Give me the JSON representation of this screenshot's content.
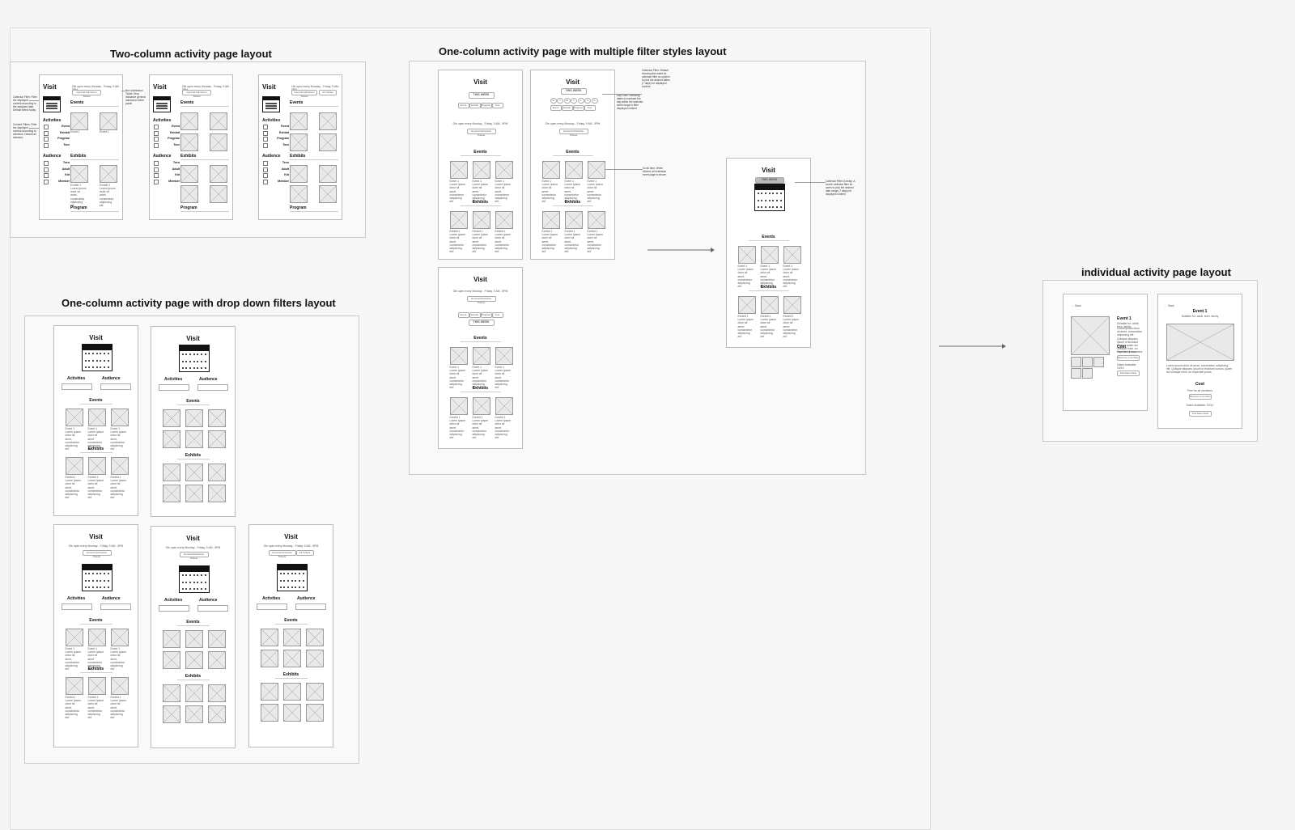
{
  "sections": {
    "two_column": "Two-column activity page layout",
    "multi_filter": "One-column activity page with multiple filter styles layout",
    "dropdown": "One-column activity page with drop down filters layout",
    "individual": "individual activity page layout"
  },
  "page": {
    "visit": "Visit",
    "hours": "Ole open every Monday - Friday, 9 AM - 5PM",
    "hours_short": "Ole open every Monday - Friday, 9 AM - 5PM",
    "plan_btn": "General Admission Tickets",
    "events": "Events",
    "exhibits": "Exhibits",
    "program": "Program",
    "activities": "Activities",
    "audience": "Audience",
    "this_week": "THIS WEEK",
    "event_item": "Event 1",
    "exhibit_item": "Exhibit 1",
    "exhibit_item2": "Exhibit 2",
    "lorem": "Lorem ipsum dolor sit amet, consectetur adipiscing elit.",
    "all_tickets": "All Tickets"
  },
  "activity_filters": [
    "Event",
    "Exhibit",
    "Program",
    "Tour"
  ],
  "audience_filters": [
    "Teen",
    "Adult",
    "Kid",
    "Member"
  ],
  "tags": [
    "Event",
    "Exhibit",
    "Program",
    "Tour"
  ],
  "days": [
    "M",
    "T",
    "W",
    "T",
    "F",
    "S",
    "S"
  ],
  "annotations": {
    "calendar_filter": "Calendar Filter: Filter the displayed content according to the assigned date. Default select today.",
    "content_filters": "Content Filters: Filter the displayed content according to selection. Default all selected.",
    "non_admission": "Non-Admission Ticket: Drop indicative general admission ticket portal",
    "day_filter": "Day Filter: Selecting dates to increase the day within the selected week range to filter displayed content",
    "scroll_item": "Scroll Item: When clicked, all individual event page is shown",
    "cal_overlay": "Calendar Filter Overlay: A month calendar filter for users to pick the desired date range (7 days) for displayed content"
  },
  "detail": {
    "back": "Back",
    "event_title": "Event 1",
    "event_sub": "Suitable for: adult, teen, family",
    "cost": "Cost",
    "cost_text": "Free for all members",
    "buy_btn": "Become a member",
    "dates_label": "Dates Available: 10/10",
    "purchase_btn": "Purchase ticket",
    "lorem": "Lorem ipsum dolor sit amet, consectetur adipiscing elit. Quisque aliquam, ipsum id tincidunt cursus, quam dui volutpat enim, eu imperdiet purus."
  }
}
